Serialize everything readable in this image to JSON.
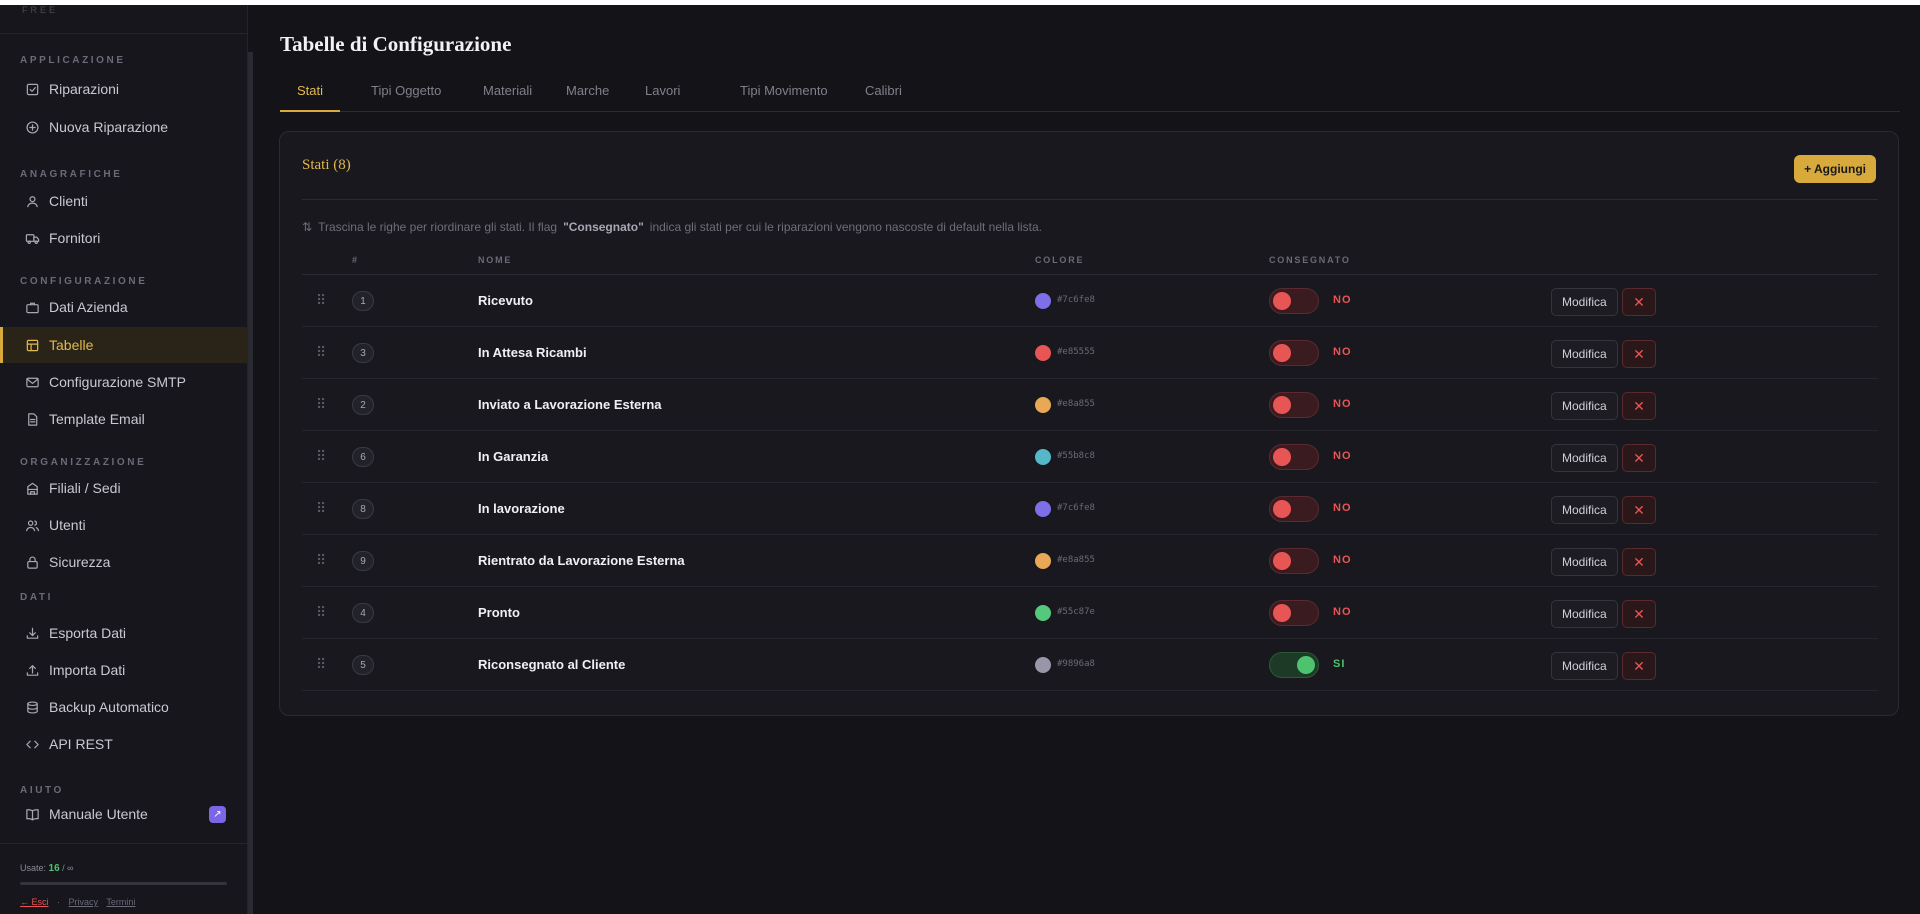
{
  "sidebar": {
    "brand_fragment": "FREE",
    "sections": [
      {
        "label": "APPLICAZIONE",
        "items": [
          {
            "label": "Riparazioni",
            "icon": "checkbox-icon"
          },
          {
            "label": "Nuova Riparazione",
            "icon": "plus-circle-icon"
          }
        ]
      },
      {
        "label": "ANAGRAFICHE",
        "items": [
          {
            "label": "Clienti",
            "icon": "user-icon"
          },
          {
            "label": "Fornitori",
            "icon": "truck-icon"
          }
        ]
      },
      {
        "label": "CONFIGURAZIONE",
        "items": [
          {
            "label": "Dati Azienda",
            "icon": "briefcase-icon"
          },
          {
            "label": "Tabelle",
            "icon": "table-icon",
            "active": true
          },
          {
            "label": "Configurazione SMTP",
            "icon": "mail-icon"
          },
          {
            "label": "Template Email",
            "icon": "file-text-icon"
          }
        ]
      },
      {
        "label": "ORGANIZZAZIONE",
        "items": [
          {
            "label": "Filiali / Sedi",
            "icon": "building-icon"
          },
          {
            "label": "Utenti",
            "icon": "users-icon"
          },
          {
            "label": "Sicurezza",
            "icon": "lock-icon"
          }
        ]
      },
      {
        "label": "DATI",
        "items": [
          {
            "label": "Esporta Dati",
            "icon": "download-icon"
          },
          {
            "label": "Importa Dati",
            "icon": "upload-icon"
          },
          {
            "label": "Backup Automatico",
            "icon": "database-icon"
          },
          {
            "label": "API REST",
            "icon": "code-icon"
          }
        ]
      },
      {
        "label": "AIUTO",
        "items": [
          {
            "label": "Manuale Utente",
            "icon": "book-icon",
            "badge": "↗"
          }
        ]
      }
    ],
    "footer": {
      "usage_label": "Usate:",
      "usage_value": "16",
      "usage_limit": "/ ∞",
      "logout": "← Esci",
      "sep": "·",
      "privacy": "Privacy",
      "terms": "Termini"
    }
  },
  "page": {
    "title": "Tabelle di Configurazione",
    "tabs": [
      "Stati",
      "Tipi Oggetto",
      "Materiali",
      "Marche",
      "Lavori",
      "Tipi Movimento",
      "Calibri"
    ],
    "active_tab": "Stati"
  },
  "card": {
    "title": "Stati (8)",
    "add_button": "+ Aggiungi",
    "hint_icon": "⇅",
    "hint_before": "Trascina le righe per riordinare gli stati. Il flag",
    "hint_bold": "\"Consegnato\"",
    "hint_after": "indica gli stati per cui le riparazioni vengono nascoste di default nella lista.",
    "columns": {
      "num": "#",
      "name": "NOME",
      "color": "COLORE",
      "delivered": "CONSEGNATO"
    },
    "edit_label": "Modifica",
    "delete_label": "✕",
    "rows": [
      {
        "order": "1",
        "name": "Ricevuto",
        "color": "#7c6fe8",
        "delivered": false,
        "flag": "NO"
      },
      {
        "order": "3",
        "name": "In Attesa Ricambi",
        "color": "#e85555",
        "delivered": false,
        "flag": "NO"
      },
      {
        "order": "2",
        "name": "Inviato a Lavorazione Esterna",
        "color": "#e8a855",
        "delivered": false,
        "flag": "NO"
      },
      {
        "order": "6",
        "name": "In Garanzia",
        "color": "#55b8c8",
        "delivered": false,
        "flag": "NO"
      },
      {
        "order": "8",
        "name": "In lavorazione",
        "color": "#7c6fe8",
        "delivered": false,
        "flag": "NO"
      },
      {
        "order": "9",
        "name": "Rientrato da Lavorazione Esterna",
        "color": "#e8a855",
        "delivered": false,
        "flag": "NO"
      },
      {
        "order": "4",
        "name": "Pronto",
        "color": "#55c87e",
        "delivered": false,
        "flag": "NO"
      },
      {
        "order": "5",
        "name": "Riconsegnato al Cliente",
        "color": "#9896a8",
        "delivered": true,
        "flag": "SI"
      }
    ]
  },
  "colors": {
    "accent": "#d8a93b",
    "danger": "#e85555",
    "success": "#4ec26e"
  }
}
